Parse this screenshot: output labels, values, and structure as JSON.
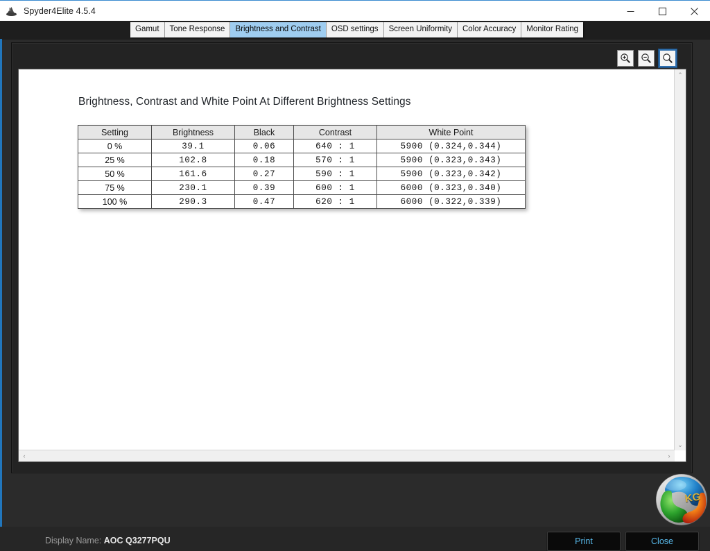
{
  "window": {
    "title": "Spyder4Elite 4.5.4",
    "icon": "spyder-icon",
    "minimize_label": "–",
    "maximize_label": "□",
    "close_label": "×"
  },
  "tabs": [
    {
      "label": "Gamut",
      "active": false
    },
    {
      "label": "Tone Response",
      "active": false
    },
    {
      "label": "Brightness and Contrast",
      "active": true
    },
    {
      "label": "OSD settings",
      "active": false
    },
    {
      "label": "Screen Uniformity",
      "active": false
    },
    {
      "label": "Color Accuracy",
      "active": false
    },
    {
      "label": "Monitor Rating",
      "active": false
    }
  ],
  "toolbar": {
    "zoom_in_label": "zoom-in",
    "zoom_out_label": "zoom-out",
    "zoom_fit_label": "zoom-select"
  },
  "report": {
    "title": "Brightness, Contrast and White Point At Different Brightness Settings",
    "columns": [
      "Setting",
      "Brightness",
      "Black",
      "Contrast",
      "White Point"
    ],
    "rows": [
      {
        "setting": "0 %",
        "brightness": "39.1",
        "black": "0.06",
        "contrast": "640 : 1",
        "white_point": "5900  (0.324,0.344)"
      },
      {
        "setting": "25 %",
        "brightness": "102.8",
        "black": "0.18",
        "contrast": "570 : 1",
        "white_point": "5900  (0.323,0.343)"
      },
      {
        "setting": "50 %",
        "brightness": "161.6",
        "black": "0.27",
        "contrast": "590 : 1",
        "white_point": "5900  (0.323,0.342)"
      },
      {
        "setting": "75 %",
        "brightness": "230.1",
        "black": "0.39",
        "contrast": "600 : 1",
        "white_point": "6000  (0.323,0.340)"
      },
      {
        "setting": "100 %",
        "brightness": "290.3",
        "black": "0.47",
        "contrast": "620 : 1",
        "white_point": "6000  (0.322,0.339)"
      }
    ]
  },
  "scrollbars": {
    "up_arrow": "⌃",
    "down_arrow": "⌄",
    "left_arrow": "‹",
    "right_arrow": "›"
  },
  "footer": {
    "display_name_label": "Display Name:",
    "display_name_value": "AOC Q3277PQU",
    "print_label": "Print",
    "close_label": "Close",
    "watermark_text": "KG"
  },
  "colors": {
    "accent_blue": "#2176bc",
    "active_tab": "#9fcdf0",
    "app_background": "#2b2b2b",
    "button_text": "#57b7e8"
  }
}
